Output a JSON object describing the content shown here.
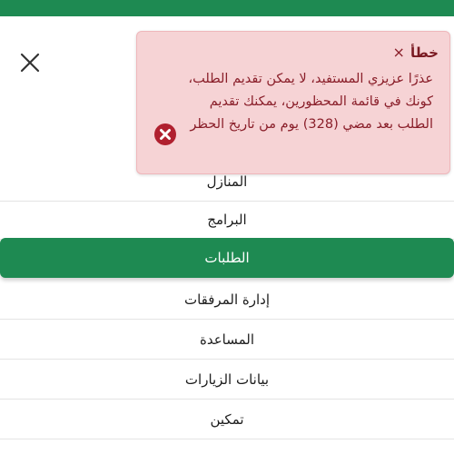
{
  "colors": {
    "brand_green": "#1e8a52",
    "toast_bg": "#f6d3d5",
    "toast_text": "#8a1f2a",
    "error_red": "#b0202f"
  },
  "header": {
    "close_icon": "close-icon",
    "logo_icon": "logo-icon"
  },
  "menu": {
    "items": [
      {
        "label": "المنازل"
      },
      {
        "label": "البرامج"
      },
      {
        "label": "الطلبات"
      },
      {
        "label": "إدارة المرفقات"
      },
      {
        "label": "المساعدة"
      },
      {
        "label": "بيانات الزيارات"
      },
      {
        "label": "تمكين"
      }
    ],
    "active_label": "الطلبات"
  },
  "toast": {
    "close_symbol": "×",
    "title": "خطأ",
    "message": "عذرًا عزيزي المستفيد، لا يمكن تقديم الطلب، كونك في قائمة المحظورين، يمكنك تقديم الطلب بعد مضي (328) يوم من تاريخ الحظر",
    "icon": "error-x-circle-icon"
  }
}
